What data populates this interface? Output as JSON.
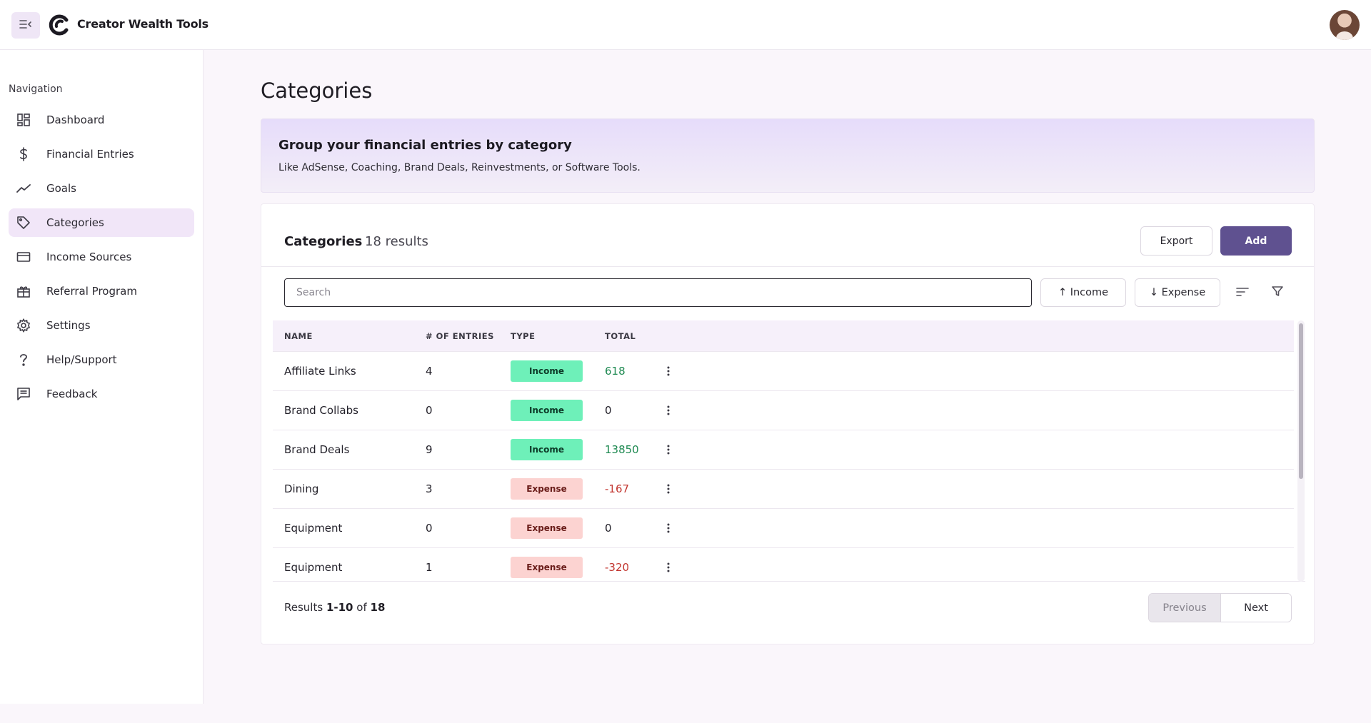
{
  "app": {
    "title": "Creator Wealth Tools",
    "menu_icon": "collapse-menu-icon",
    "logo_icon": "creator-logo-icon",
    "avatar_icon": "user-avatar"
  },
  "colors": {
    "accent": "#5f5190",
    "income_badge": "#6ef0b9",
    "expense_badge": "#fcd3d1",
    "positive_total": "#1f8a52",
    "negative_total": "#c2352f",
    "active_nav": "#f1e6f8"
  },
  "sidebar": {
    "heading": "Navigation",
    "items": [
      {
        "label": "Dashboard",
        "icon": "dashboard-icon",
        "active": false
      },
      {
        "label": "Financial Entries",
        "icon": "dollar-icon",
        "active": false
      },
      {
        "label": "Goals",
        "icon": "trend-line-icon",
        "active": false
      },
      {
        "label": "Categories",
        "icon": "tag-icon",
        "active": true
      },
      {
        "label": "Income Sources",
        "icon": "card-icon",
        "active": false
      },
      {
        "label": "Referral Program",
        "icon": "gift-icon",
        "active": false
      },
      {
        "label": "Settings",
        "icon": "gear-icon",
        "active": false
      },
      {
        "label": "Help/Support",
        "icon": "question-icon",
        "active": false
      },
      {
        "label": "Feedback",
        "icon": "feedback-icon",
        "active": false
      }
    ]
  },
  "page": {
    "title": "Categories",
    "banner_title": "Group your financial entries by category",
    "banner_subtitle": "Like AdSense, Coaching, Brand Deals, Reinvestments, or Software Tools."
  },
  "card": {
    "title": "Categories",
    "count": "18 results",
    "export_label": "Export",
    "add_label": "Add",
    "search_placeholder": "Search",
    "income_filter_label": "↑ Income",
    "expense_filter_label": "↓ Expense",
    "sort_icon": "sort-icon",
    "filter_icon": "filter-icon"
  },
  "table": {
    "columns": [
      "NAME",
      "# OF ENTRIES",
      "TYPE",
      "TOTAL"
    ],
    "rows": [
      {
        "name": "Affiliate Links",
        "entries": "4",
        "type": "Income",
        "total": "618"
      },
      {
        "name": "Brand Collabs",
        "entries": "0",
        "type": "Income",
        "total": "0"
      },
      {
        "name": "Brand Deals",
        "entries": "9",
        "type": "Income",
        "total": "13850"
      },
      {
        "name": "Dining",
        "entries": "3",
        "type": "Expense",
        "total": "-167"
      },
      {
        "name": "Equipment",
        "entries": "0",
        "type": "Expense",
        "total": "0"
      },
      {
        "name": "Equipment",
        "entries": "1",
        "type": "Expense",
        "total": "-320"
      }
    ]
  },
  "pagination": {
    "results_prefix": "Results",
    "range": "1-10",
    "of_label": "of",
    "total": "18",
    "previous_label": "Previous",
    "next_label": "Next"
  }
}
